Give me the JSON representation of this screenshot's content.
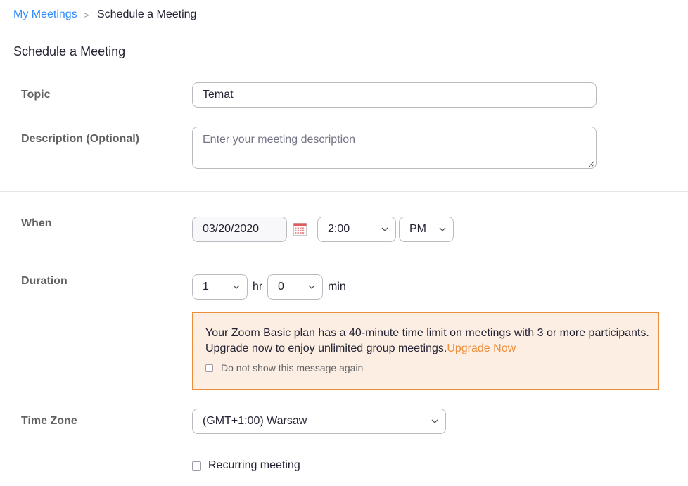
{
  "breadcrumb": {
    "parent_label": "My Meetings",
    "separator": ">",
    "current_label": "Schedule a Meeting"
  },
  "page_title": "Schedule a Meeting",
  "topic": {
    "label": "Topic",
    "value": "Temat"
  },
  "description": {
    "label": "Description (Optional)",
    "placeholder": "Enter your meeting description"
  },
  "when": {
    "label": "When",
    "date": "03/20/2020",
    "calendar_icon": "calendar-icon",
    "time": "2:00",
    "ampm": "PM"
  },
  "duration": {
    "label": "Duration",
    "hours": "1",
    "hours_unit": "hr",
    "minutes": "0",
    "minutes_unit": "min"
  },
  "notice": {
    "message": "Your Zoom Basic plan has a 40-minute time limit on meetings with 3 or more participants. Upgrade now to enjoy unlimited group meetings.",
    "link_label": "Upgrade Now",
    "dont_show_label": "Do not show this message again",
    "dont_show_checked": false,
    "border_color": "#ed8e3c",
    "background_color": "#fdeee4"
  },
  "timezone": {
    "label": "Time Zone",
    "value": "(GMT+1:00) Warsaw"
  },
  "recurring": {
    "label": "Recurring meeting",
    "checked": false
  },
  "colors": {
    "link": "#2d8cff",
    "accent": "#ed8e3c",
    "label": "#616264"
  }
}
